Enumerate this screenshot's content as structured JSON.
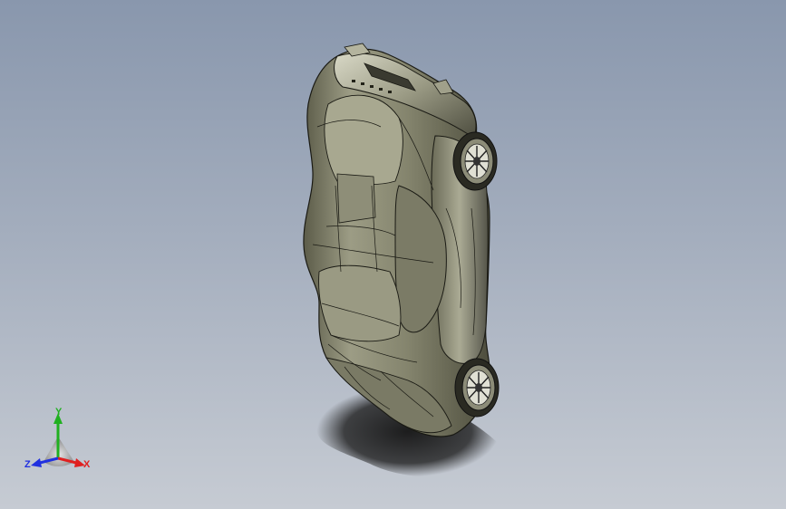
{
  "viewport": {
    "background_top": "#8997ad",
    "background_bottom": "#c6cbd3",
    "model_color": "#8a8a74",
    "model_shade": "#5f5f4d",
    "model_highlight": "#c9c9b5",
    "edge_color": "#1a1a14",
    "shadow_color": "#1e1e1e"
  },
  "triad": {
    "x_label": "X",
    "y_label": "Y",
    "z_label": "Z",
    "x_color": "#e02020",
    "y_color": "#20b020",
    "z_color": "#2030e0"
  }
}
